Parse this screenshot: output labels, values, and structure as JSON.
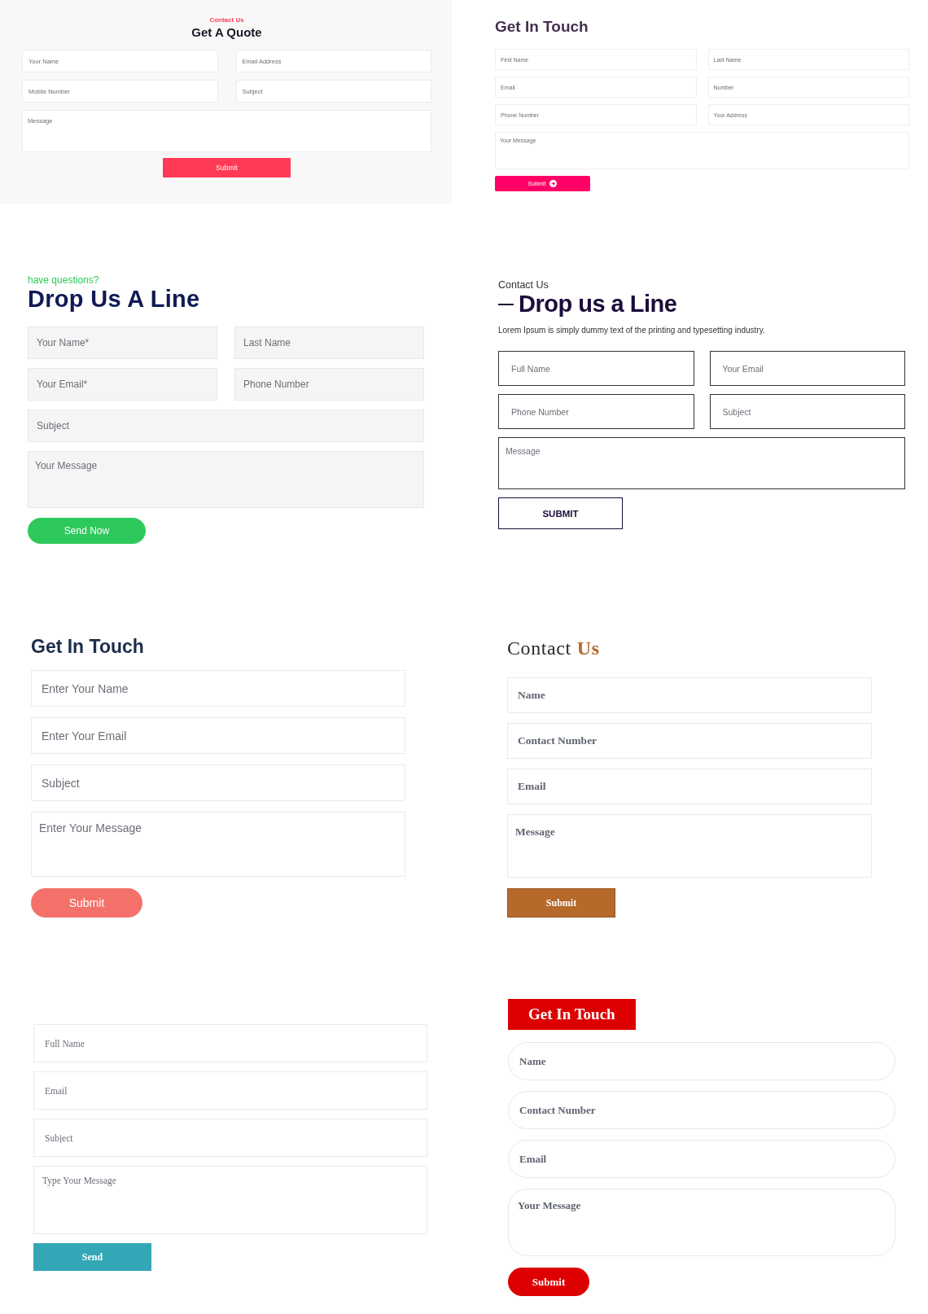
{
  "forms": [
    {
      "kind": "quote",
      "eyebrow": "Contact Us",
      "title": "Get A Quote",
      "fields": [
        {
          "kind": "half",
          "placeholder": "Your Name"
        },
        {
          "kind": "half",
          "placeholder": "Email Address"
        },
        {
          "kind": "half",
          "placeholder": "Mobile Number"
        },
        {
          "kind": "half",
          "placeholder": "Subject"
        },
        {
          "kind": "textarea",
          "placeholder": "Message"
        }
      ],
      "button": "Submit"
    },
    {
      "kind": "pink",
      "title": "Get In Touch",
      "fields": [
        {
          "kind": "half",
          "placeholder": "First Name"
        },
        {
          "kind": "half",
          "placeholder": "Last Name"
        },
        {
          "kind": "half",
          "placeholder": "Email"
        },
        {
          "kind": "half",
          "placeholder": "Number"
        },
        {
          "kind": "half",
          "placeholder": "Phone Number"
        },
        {
          "kind": "half",
          "placeholder": "Your Address"
        },
        {
          "kind": "textarea",
          "placeholder": "Your Message"
        }
      ],
      "button": "Submit"
    },
    {
      "kind": "green",
      "eyebrow": "have questions?",
      "title": "Drop Us A Line",
      "fields": [
        {
          "kind": "half",
          "placeholder": "Your Name*"
        },
        {
          "kind": "half",
          "placeholder": "Last Name"
        },
        {
          "kind": "half",
          "placeholder": "Your Email*"
        },
        {
          "kind": "half",
          "placeholder": "Phone Number"
        },
        {
          "kind": "full",
          "placeholder": "Subject"
        },
        {
          "kind": "textarea",
          "placeholder": "Your Message"
        }
      ],
      "button": "Send Now"
    },
    {
      "kind": "outline",
      "eyebrow": "Contact Us",
      "title": "Drop us a Line",
      "description": "Lorem Ipsum is simply dummy text of the printing and typesetting industry.",
      "fields": [
        {
          "kind": "half",
          "placeholder": "Full Name"
        },
        {
          "kind": "half",
          "placeholder": "Your Email"
        },
        {
          "kind": "half",
          "placeholder": "Phone Number"
        },
        {
          "kind": "half",
          "placeholder": "Subject"
        },
        {
          "kind": "textarea",
          "placeholder": "Message"
        }
      ],
      "button": "SUBMIT"
    },
    {
      "kind": "coral",
      "title": "Get In Touch",
      "fields": [
        {
          "kind": "full",
          "placeholder": "Enter Your Name"
        },
        {
          "kind": "full",
          "placeholder": "Enter Your Email"
        },
        {
          "kind": "full",
          "placeholder": "Subject"
        },
        {
          "kind": "textarea",
          "placeholder": "Enter Your Message"
        }
      ],
      "button": "Submit"
    },
    {
      "kind": "bronze",
      "title": "Contact",
      "title_accent": "Us",
      "fields": [
        {
          "kind": "full",
          "placeholder": "Name"
        },
        {
          "kind": "full",
          "placeholder": "Contact Number"
        },
        {
          "kind": "full",
          "placeholder": "Email"
        },
        {
          "kind": "textarea",
          "placeholder": "Message"
        }
      ],
      "button": "Submit"
    },
    {
      "kind": "teal",
      "fields": [
        {
          "kind": "full",
          "placeholder": "Full Name"
        },
        {
          "kind": "full",
          "placeholder": "Email"
        },
        {
          "kind": "full",
          "placeholder": "Subject"
        },
        {
          "kind": "textarea",
          "placeholder": "Type Your Message"
        }
      ],
      "button": "Send"
    },
    {
      "kind": "redpill",
      "title": "Get In Touch",
      "fields": [
        {
          "kind": "full",
          "placeholder": "Name"
        },
        {
          "kind": "full",
          "placeholder": "Contact Number"
        },
        {
          "kind": "full",
          "placeholder": "Email"
        },
        {
          "kind": "textarea",
          "placeholder": "Your Message"
        }
      ],
      "button": "Submit"
    }
  ]
}
